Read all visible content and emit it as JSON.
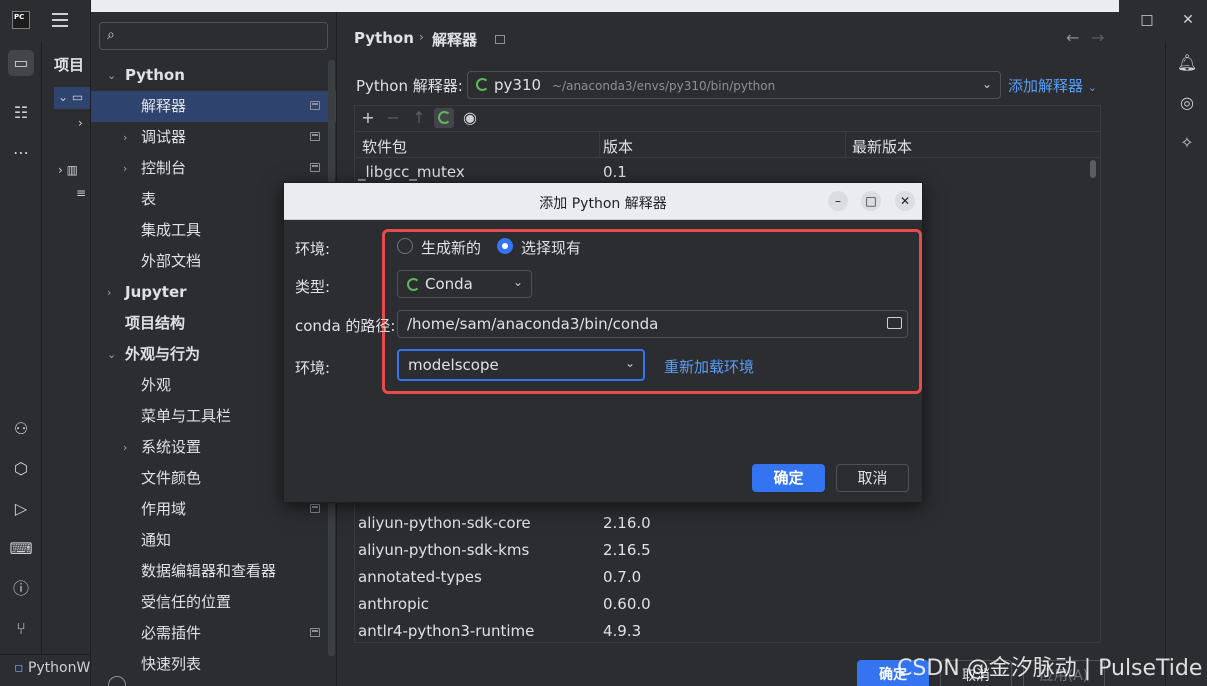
{
  "ide": {
    "logo_text": "PC",
    "project_label": "项目",
    "status_project": "PythonW"
  },
  "settings": {
    "nav": [
      {
        "label": "Python",
        "level": 0,
        "expanded": true,
        "bold": true
      },
      {
        "label": "解释器",
        "level": 1,
        "selected": true,
        "pin": true
      },
      {
        "label": "调试器",
        "level": 1,
        "collapsed": true,
        "pin": true
      },
      {
        "label": "控制台",
        "level": 1,
        "collapsed": true,
        "pin": true
      },
      {
        "label": "表",
        "level": 1
      },
      {
        "label": "集成工具",
        "level": 1
      },
      {
        "label": "外部文档",
        "level": 1
      },
      {
        "label": "Jupyter",
        "level": 0,
        "collapsed": true,
        "bold": true
      },
      {
        "label": "项目结构",
        "level": 0,
        "bold": true
      },
      {
        "label": "外观与行为",
        "level": 0,
        "expanded": true,
        "bold": true
      },
      {
        "label": "外观",
        "level": 1
      },
      {
        "label": "菜单与工具栏",
        "level": 1
      },
      {
        "label": "系统设置",
        "level": 1,
        "collapsed": true
      },
      {
        "label": "文件颜色",
        "level": 1
      },
      {
        "label": "作用域",
        "level": 1,
        "pin": true
      },
      {
        "label": "通知",
        "level": 1
      },
      {
        "label": "数据编辑器和查看器",
        "level": 1
      },
      {
        "label": "受信任的位置",
        "level": 1
      },
      {
        "label": "必需插件",
        "level": 1,
        "pin": true
      },
      {
        "label": "快速列表",
        "level": 1
      }
    ],
    "breadcrumb": {
      "root": "Python",
      "page": "解释器"
    },
    "interpreter_label": "Python 解释器:",
    "interpreter_name": "py310",
    "interpreter_path": "~/anaconda3/envs/py310/bin/python",
    "add_interpreter": "添加解释器",
    "table": {
      "headers": [
        "软件包",
        "版本",
        "最新版本"
      ],
      "rows_top": [
        {
          "name": "_libgcc_mutex",
          "version": "0.1"
        }
      ],
      "rows_bottom": [
        {
          "name": "aliyun-python-sdk-core",
          "version": "2.16.0"
        },
        {
          "name": "aliyun-python-sdk-kms",
          "version": "2.16.5"
        },
        {
          "name": "annotated-types",
          "version": "0.7.0"
        },
        {
          "name": "anthropic",
          "version": "0.60.0"
        },
        {
          "name": "antlr4-python3-runtime",
          "version": "4.9.3"
        }
      ]
    },
    "buttons": {
      "ok": "确定",
      "cancel": "取消",
      "apply": "应用(A)"
    }
  },
  "dialog": {
    "title": "添加 Python 解释器",
    "env_label": "环境:",
    "radio_new": "生成新的",
    "radio_existing": "选择现有",
    "type_label": "类型:",
    "type_value": "Conda",
    "conda_path_label": "conda 的路径:",
    "conda_path_value": "/home/sam/anaconda3/bin/conda",
    "env2_label": "环境:",
    "env_value": "modelscope",
    "reload_link": "重新加载环境",
    "ok": "确定",
    "cancel": "取消"
  },
  "watermark": "CSDN @金汐脉动 | PulseTide",
  "colors": {
    "accent": "#3574f0",
    "link": "#589df6",
    "highlight": "#e74c4c",
    "selection": "#2e436e"
  }
}
